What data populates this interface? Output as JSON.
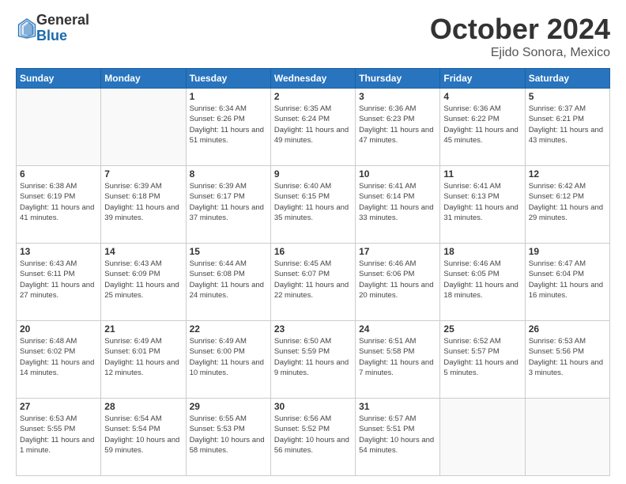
{
  "header": {
    "logo_general": "General",
    "logo_blue": "Blue",
    "title": "October 2024",
    "location": "Ejido Sonora, Mexico"
  },
  "days_of_week": [
    "Sunday",
    "Monday",
    "Tuesday",
    "Wednesday",
    "Thursday",
    "Friday",
    "Saturday"
  ],
  "weeks": [
    [
      {
        "day": "",
        "info": ""
      },
      {
        "day": "",
        "info": ""
      },
      {
        "day": "1",
        "sunrise": "6:34 AM",
        "sunset": "6:26 PM",
        "daylight": "11 hours and 51 minutes."
      },
      {
        "day": "2",
        "sunrise": "6:35 AM",
        "sunset": "6:24 PM",
        "daylight": "11 hours and 49 minutes."
      },
      {
        "day": "3",
        "sunrise": "6:36 AM",
        "sunset": "6:23 PM",
        "daylight": "11 hours and 47 minutes."
      },
      {
        "day": "4",
        "sunrise": "6:36 AM",
        "sunset": "6:22 PM",
        "daylight": "11 hours and 45 minutes."
      },
      {
        "day": "5",
        "sunrise": "6:37 AM",
        "sunset": "6:21 PM",
        "daylight": "11 hours and 43 minutes."
      }
    ],
    [
      {
        "day": "6",
        "sunrise": "6:38 AM",
        "sunset": "6:19 PM",
        "daylight": "11 hours and 41 minutes."
      },
      {
        "day": "7",
        "sunrise": "6:39 AM",
        "sunset": "6:18 PM",
        "daylight": "11 hours and 39 minutes."
      },
      {
        "day": "8",
        "sunrise": "6:39 AM",
        "sunset": "6:17 PM",
        "daylight": "11 hours and 37 minutes."
      },
      {
        "day": "9",
        "sunrise": "6:40 AM",
        "sunset": "6:15 PM",
        "daylight": "11 hours and 35 minutes."
      },
      {
        "day": "10",
        "sunrise": "6:41 AM",
        "sunset": "6:14 PM",
        "daylight": "11 hours and 33 minutes."
      },
      {
        "day": "11",
        "sunrise": "6:41 AM",
        "sunset": "6:13 PM",
        "daylight": "11 hours and 31 minutes."
      },
      {
        "day": "12",
        "sunrise": "6:42 AM",
        "sunset": "6:12 PM",
        "daylight": "11 hours and 29 minutes."
      }
    ],
    [
      {
        "day": "13",
        "sunrise": "6:43 AM",
        "sunset": "6:11 PM",
        "daylight": "11 hours and 27 minutes."
      },
      {
        "day": "14",
        "sunrise": "6:43 AM",
        "sunset": "6:09 PM",
        "daylight": "11 hours and 25 minutes."
      },
      {
        "day": "15",
        "sunrise": "6:44 AM",
        "sunset": "6:08 PM",
        "daylight": "11 hours and 24 minutes."
      },
      {
        "day": "16",
        "sunrise": "6:45 AM",
        "sunset": "6:07 PM",
        "daylight": "11 hours and 22 minutes."
      },
      {
        "day": "17",
        "sunrise": "6:46 AM",
        "sunset": "6:06 PM",
        "daylight": "11 hours and 20 minutes."
      },
      {
        "day": "18",
        "sunrise": "6:46 AM",
        "sunset": "6:05 PM",
        "daylight": "11 hours and 18 minutes."
      },
      {
        "day": "19",
        "sunrise": "6:47 AM",
        "sunset": "6:04 PM",
        "daylight": "11 hours and 16 minutes."
      }
    ],
    [
      {
        "day": "20",
        "sunrise": "6:48 AM",
        "sunset": "6:02 PM",
        "daylight": "11 hours and 14 minutes."
      },
      {
        "day": "21",
        "sunrise": "6:49 AM",
        "sunset": "6:01 PM",
        "daylight": "11 hours and 12 minutes."
      },
      {
        "day": "22",
        "sunrise": "6:49 AM",
        "sunset": "6:00 PM",
        "daylight": "11 hours and 10 minutes."
      },
      {
        "day": "23",
        "sunrise": "6:50 AM",
        "sunset": "5:59 PM",
        "daylight": "11 hours and 9 minutes."
      },
      {
        "day": "24",
        "sunrise": "6:51 AM",
        "sunset": "5:58 PM",
        "daylight": "11 hours and 7 minutes."
      },
      {
        "day": "25",
        "sunrise": "6:52 AM",
        "sunset": "5:57 PM",
        "daylight": "11 hours and 5 minutes."
      },
      {
        "day": "26",
        "sunrise": "6:53 AM",
        "sunset": "5:56 PM",
        "daylight": "11 hours and 3 minutes."
      }
    ],
    [
      {
        "day": "27",
        "sunrise": "6:53 AM",
        "sunset": "5:55 PM",
        "daylight": "11 hours and 1 minute."
      },
      {
        "day": "28",
        "sunrise": "6:54 AM",
        "sunset": "5:54 PM",
        "daylight": "10 hours and 59 minutes."
      },
      {
        "day": "29",
        "sunrise": "6:55 AM",
        "sunset": "5:53 PM",
        "daylight": "10 hours and 58 minutes."
      },
      {
        "day": "30",
        "sunrise": "6:56 AM",
        "sunset": "5:52 PM",
        "daylight": "10 hours and 56 minutes."
      },
      {
        "day": "31",
        "sunrise": "6:57 AM",
        "sunset": "5:51 PM",
        "daylight": "10 hours and 54 minutes."
      },
      {
        "day": "",
        "info": ""
      },
      {
        "day": "",
        "info": ""
      }
    ]
  ]
}
